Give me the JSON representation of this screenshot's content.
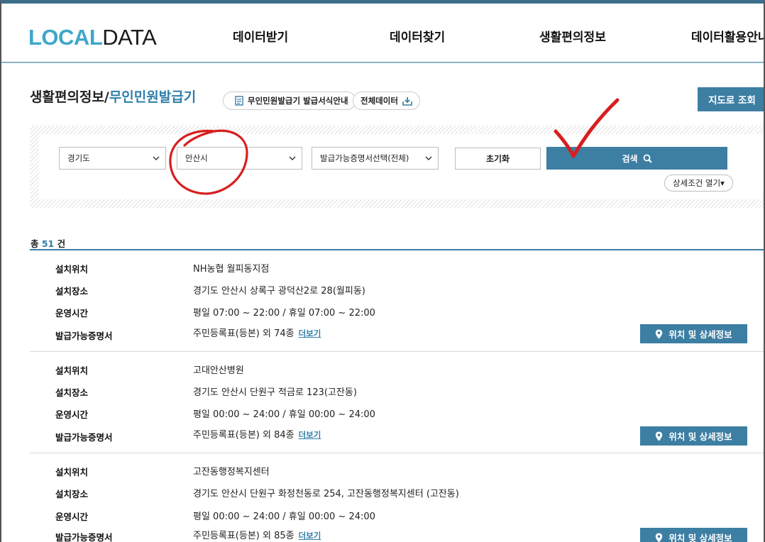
{
  "logo": {
    "part1": "LOCAL",
    "part2": "DATA"
  },
  "nav": [
    "데이터받기",
    "데이터찾기",
    "생활편의정보",
    "데이터활용안내"
  ],
  "title": {
    "main": "생활편의정보/",
    "accent": "무인민원발급기"
  },
  "pills": {
    "guide": "무인민원발급기 발급서식안내",
    "all_data": "전체데이터"
  },
  "map_button": "지도로 조회",
  "search": {
    "province": "경기도",
    "city": "안산시",
    "certificate": "발급가능증명서선택(전체)",
    "reset": "초기화",
    "search": "검색",
    "detail": "상세조건 열기▾"
  },
  "count": {
    "prefix": "총 ",
    "num": "51",
    "suffix": " 건"
  },
  "labels": {
    "location": "설치위치",
    "place": "설치장소",
    "hours": "운영시간",
    "certs": "발급가능증명서",
    "more": "더보기",
    "detail_btn": "위치 및 상세정보"
  },
  "results": [
    {
      "location": "NH농협 월피동지점",
      "place": "경기도 안산시 상록구 광덕산2로 28(월피동)",
      "hours": "평일 07:00 ~ 22:00 / 휴일 07:00 ~ 22:00",
      "certs": "주민등록표(등본) 외 74종"
    },
    {
      "location": "고대안산병원",
      "place": "경기도 안산시 단원구 적금로 123(고잔동)",
      "hours": "평일 00:00 ~ 24:00 / 휴일 00:00 ~ 24:00",
      "certs": "주민등록표(등본) 외 84종"
    },
    {
      "location": "고잔동행정복지센터",
      "place": "경기도 안산시 단원구 화정천동로 254, 고잔동행정복지센터 (고잔동)",
      "hours": "평일 00:00 ~ 24:00 / 휴일 00:00 ~ 24:00",
      "certs": "주민등록표(등본) 외 85종"
    }
  ],
  "colors": {
    "accent": "#3d7ea3",
    "logo_blue": "#3ea7c9",
    "annotation_red": "#d81e1e"
  }
}
